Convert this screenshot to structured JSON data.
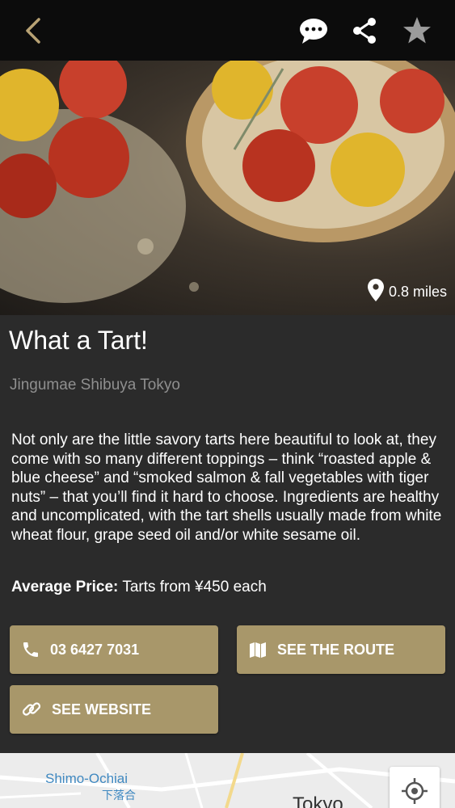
{
  "header": {
    "back_icon": "chevron-left-icon",
    "actions": [
      "chat-icon",
      "share-icon",
      "star-icon"
    ]
  },
  "hero": {
    "distance": "0.8 miles",
    "icon": "location-pin-icon"
  },
  "place": {
    "name": "What a Tart!",
    "address": "Jingumae Shibuya Tokyo",
    "description": "Not only are the little savory tarts here beautiful to look at, they come with so many different toppings – think “roasted apple & blue cheese” and “smoked salmon & fall vegetables with tiger nuts” – that you’ll find it hard to choose. Ingredients are healthy and uncomplicated, with the tart shells usually made from white wheat flour, grape seed oil and/or white sesame oil.",
    "price_label": "Average Price:",
    "price_value": "Tarts from ¥450 each"
  },
  "buttons": {
    "phone": "03 6427 7031",
    "route": "SEE THE ROUTE",
    "website": "SEE WEBSITE"
  },
  "map": {
    "label_en": "Shimo-Ochiai",
    "label_jp": "下落合",
    "city": "Tokyo"
  },
  "colors": {
    "topbar": "#0c0c0c",
    "background": "#2b2b2b",
    "button": "#a8976a",
    "accent_gold": "#b8a274"
  }
}
